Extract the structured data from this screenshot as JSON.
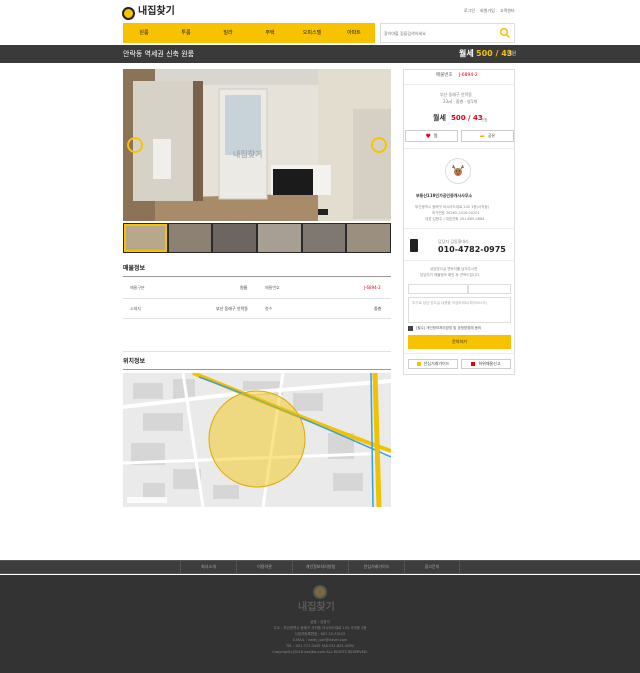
{
  "header": {
    "logo_text": "내집찾기",
    "top_links": [
      "로그인",
      "회원가입",
      "고객센터"
    ],
    "nav": [
      "원룸",
      "투룸",
      "빌라",
      "주택",
      "오피스텔",
      "아파트"
    ],
    "search_placeholder": "찾아야할 집을검색하세요"
  },
  "title_bar": {
    "title": "안락동 역세권 신축 원룸",
    "price_label": "월세",
    "price_value": "500 / 43",
    "price_unit": "만원"
  },
  "gallery": {
    "watermark": "내집찾기",
    "thumb_count": 6
  },
  "info": {
    "title": "매물정보",
    "rows": [
      {
        "k1": "매물구분",
        "v1": "원룸",
        "k2": "매물번호",
        "v2": "J-6894-2"
      },
      {
        "k1": "소재지",
        "v1": "부산 동래구 안락동",
        "k2": "층수",
        "v2": "중층"
      }
    ]
  },
  "location": {
    "title": "위치정보"
  },
  "sidebar": {
    "listing_label": "매물번호",
    "listing_no": "J-6894-2",
    "address": "부산 동래구 안락동",
    "detail": "23㎡ · 중층 · 방1개",
    "price_label": "월세",
    "price_value": "500 / 43",
    "price_unit": "만원",
    "like": "찜",
    "share": "공유",
    "agency_name": "부동산119인가공인중개사사무소",
    "agency_lines": [
      "부산광역시 동래구 아시아드대로 145 1층(사직동)",
      "허가번호 26260-2016-00201",
      "대표 김현주 / 대표전화 051-865-0884"
    ],
    "agent_label": "담당자 김동휘대리",
    "agent_phone": "010-4782-0975",
    "inquiry_text": [
      "상담받으실 연락처를 남겨주시면",
      "담당자가 매물정보 확인 후 연락드립니다."
    ],
    "name_placeholder": "",
    "phone_placeholder": "",
    "message_placeholder": "추가로 상담 받으실 내용을 작성하세요(최대500자)",
    "agree_text": "[필수] 개인정보처리방침 및 공정방침에 동의",
    "submit": "문의하기",
    "guide_btn": "안심거래가이드",
    "report_btn": "허위매물신고"
  },
  "footer": {
    "links": [
      "회사소개",
      "이용약관",
      "개인정보처리방침",
      "안심거래가이드",
      "광고문의"
    ],
    "logo_text": "내집찾기",
    "lines": [
      "상호 : 김영석",
      "주소 : 부산광역시 동래구 사직동 아시아드대로 145 사직동 2층",
      "사업자등록번호 : 607-20-33125",
      "E-MAIL : kwdy_uoh@naver.com",
      "TEL : 051-717-0445  FAX:051-851-0894",
      "Copyright(c)2016 naejibs.com ALL RIGHTS RESERVED."
    ]
  },
  "colors": {
    "accent": "#f7c300",
    "dark": "#3a3a3a",
    "red": "#e60012"
  }
}
